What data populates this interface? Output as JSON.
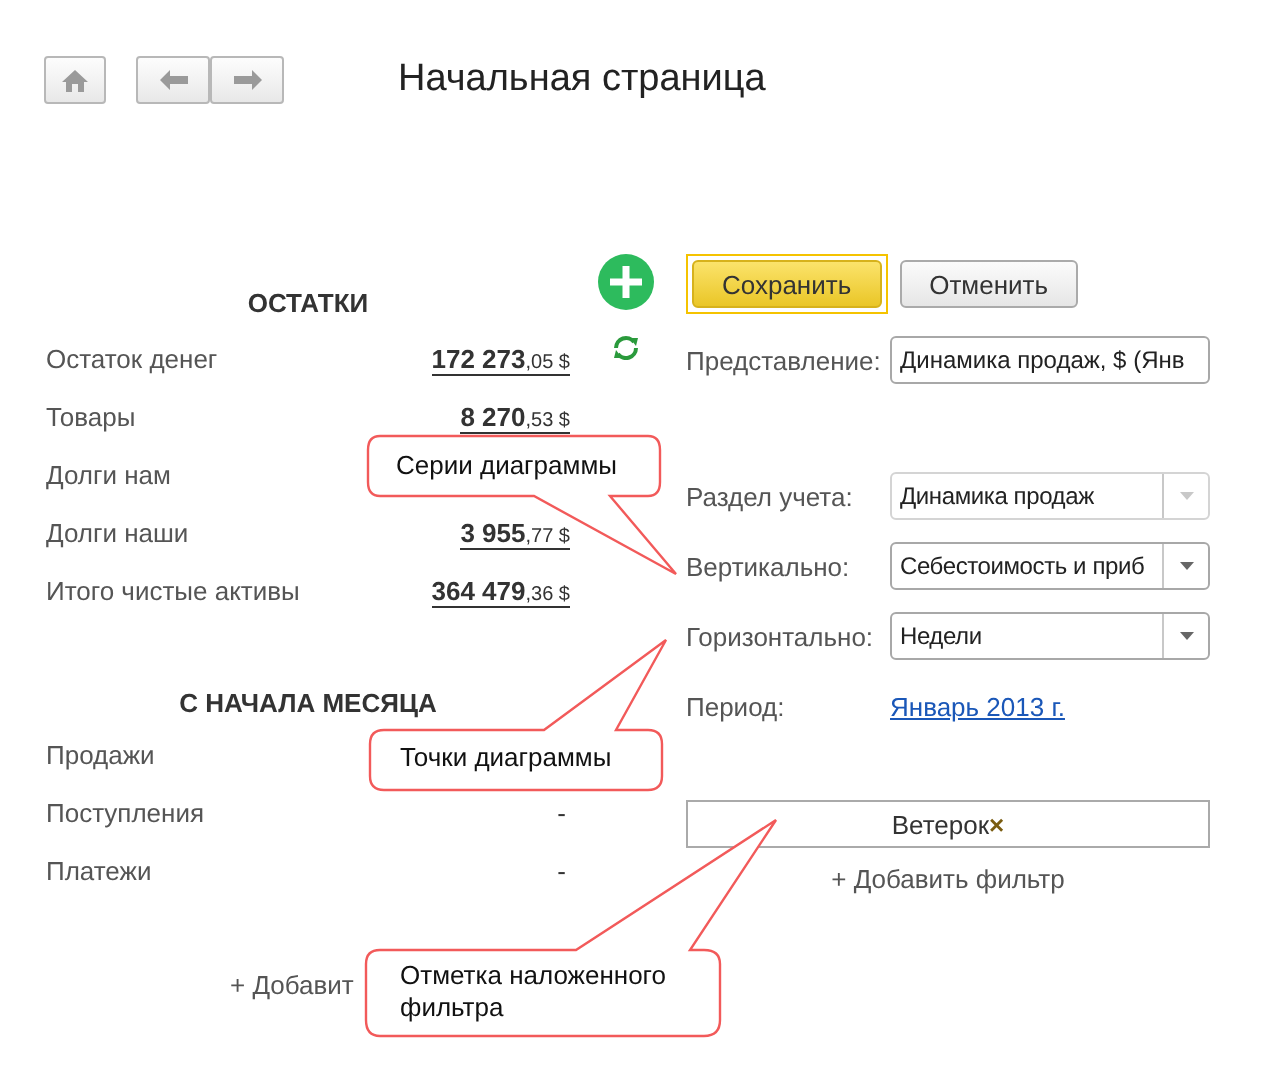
{
  "title": "Начальная страница",
  "balances": {
    "heading": "ОСТАТКИ",
    "rows": [
      {
        "label": "Остаток денег",
        "integer": "172 273",
        "fraction": ",05 $"
      },
      {
        "label": "Товары",
        "integer": "8 270",
        "fraction": ",53 $"
      },
      {
        "label": "Долги нам"
      },
      {
        "label": "Долги наши",
        "integer": "3 955",
        "fraction": ",77 $"
      },
      {
        "label": "Итого чистые активы",
        "integer": "364 479",
        "fraction": ",36 $"
      }
    ]
  },
  "month": {
    "heading": "С НАЧАЛА МЕСЯЦА",
    "rows": [
      {
        "label": "Продажи"
      },
      {
        "label": "Поступления",
        "value": "-"
      },
      {
        "label": "Платежи",
        "value": "-"
      }
    ]
  },
  "add_link": "+ Добавит",
  "form": {
    "buttons": [
      {
        "label": "Сохранить",
        "default": true
      },
      {
        "label": "Отменить",
        "default": false
      }
    ],
    "fields": [
      {
        "kind": "text",
        "label": "Представление:",
        "value": "Динамика продаж, $ (Янв"
      },
      {
        "kind": "select",
        "label": "Раздел учета:",
        "value": "Динамика продаж",
        "disabled": true
      },
      {
        "kind": "select",
        "label": "Вертикально:",
        "value": "Себестоимость и приб",
        "disabled": false
      },
      {
        "kind": "select",
        "label": "Горизонтально:",
        "value": "Недели",
        "disabled": false
      },
      {
        "kind": "link",
        "label": "Период:",
        "value": "Январь 2013 г."
      }
    ],
    "filter": {
      "value": "Ветерок",
      "remove": "×"
    },
    "add_filter": "+ Добавить фильтр"
  },
  "callouts": [
    {
      "text": "Серии диаграммы"
    },
    {
      "text": "Точки диаграммы"
    },
    {
      "text": "Отметка наложенного фильтра"
    }
  ]
}
